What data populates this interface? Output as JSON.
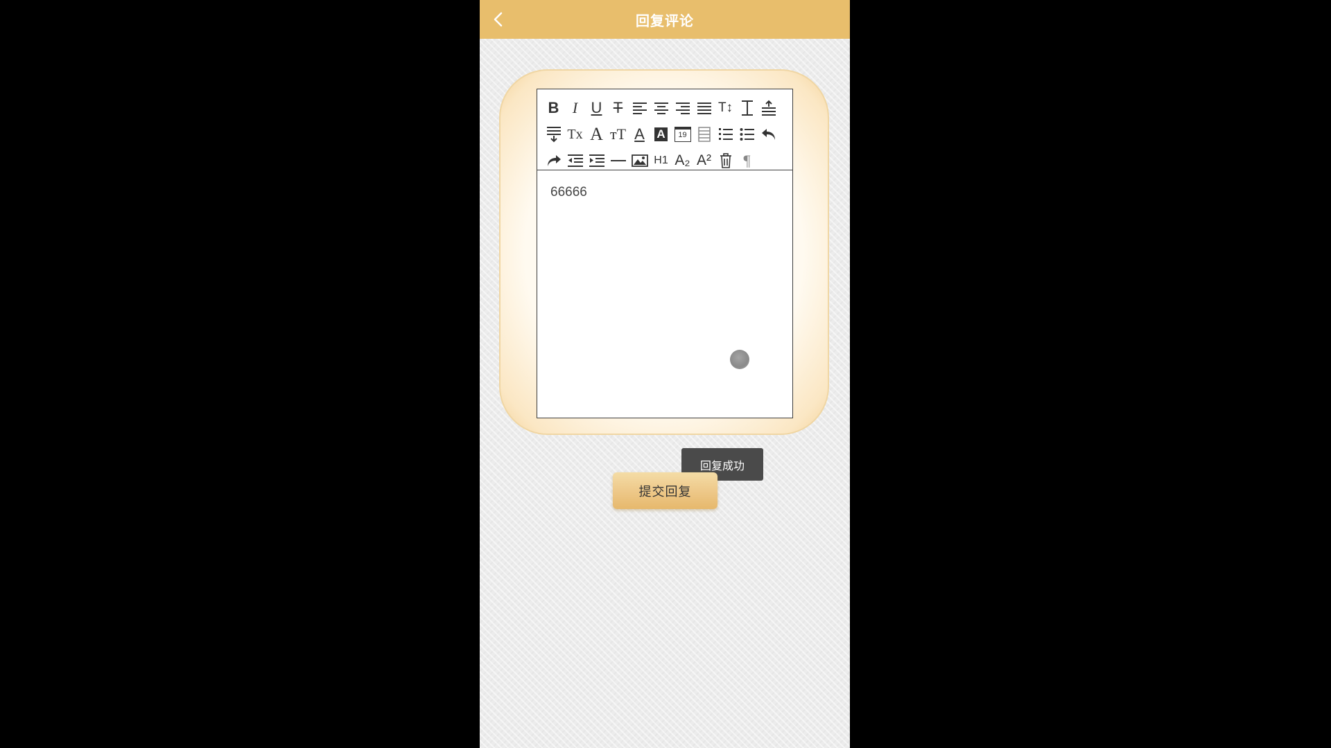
{
  "header": {
    "title": "回复评论",
    "back_icon": "chevron-left-icon"
  },
  "toolbar": {
    "rows": [
      [
        {
          "icon": "bold-icon",
          "glyph": "B"
        },
        {
          "icon": "italic-icon",
          "glyph": "I"
        },
        {
          "icon": "underline-icon",
          "glyph": "U"
        },
        {
          "icon": "strikethrough-icon",
          "glyph": "T"
        },
        {
          "icon": "align-left-icon"
        },
        {
          "icon": "align-center-icon"
        },
        {
          "icon": "align-right-icon"
        },
        {
          "icon": "align-justify-icon"
        },
        {
          "icon": "text-direction-icon",
          "glyph": "T↕"
        },
        {
          "icon": "line-height-icon"
        },
        {
          "icon": "row-spacing-top-icon"
        }
      ],
      [
        {
          "icon": "row-spacing-bottom-icon"
        },
        {
          "icon": "remove-format-icon",
          "glyph": "Tx"
        },
        {
          "icon": "font-family-icon",
          "glyph": "A"
        },
        {
          "icon": "font-size-icon",
          "glyph": "тT"
        },
        {
          "icon": "font-color-icon",
          "glyph": "A"
        },
        {
          "icon": "background-color-icon",
          "glyph": "A"
        },
        {
          "icon": "insert-date-icon",
          "glyph": "19"
        },
        {
          "icon": "insert-table-icon"
        },
        {
          "icon": "ordered-list-icon"
        },
        {
          "icon": "unordered-list-icon"
        },
        {
          "icon": "undo-icon",
          "glyph": "↶"
        }
      ],
      [
        {
          "icon": "redo-icon",
          "glyph": "↷"
        },
        {
          "icon": "outdent-icon"
        },
        {
          "icon": "indent-icon"
        },
        {
          "icon": "horizontal-rule-icon"
        },
        {
          "icon": "insert-image-icon"
        },
        {
          "icon": "heading-icon",
          "glyph": "H1"
        },
        {
          "icon": "subscript-icon",
          "glyph": "A₂"
        },
        {
          "icon": "superscript-icon",
          "glyph": "A²"
        },
        {
          "icon": "clear-content-icon"
        },
        {
          "icon": "paragraph-icon",
          "glyph": "¶"
        }
      ]
    ]
  },
  "editor": {
    "content": "66666"
  },
  "toast": {
    "message": "回复成功"
  },
  "submit": {
    "label": "提交回复"
  }
}
